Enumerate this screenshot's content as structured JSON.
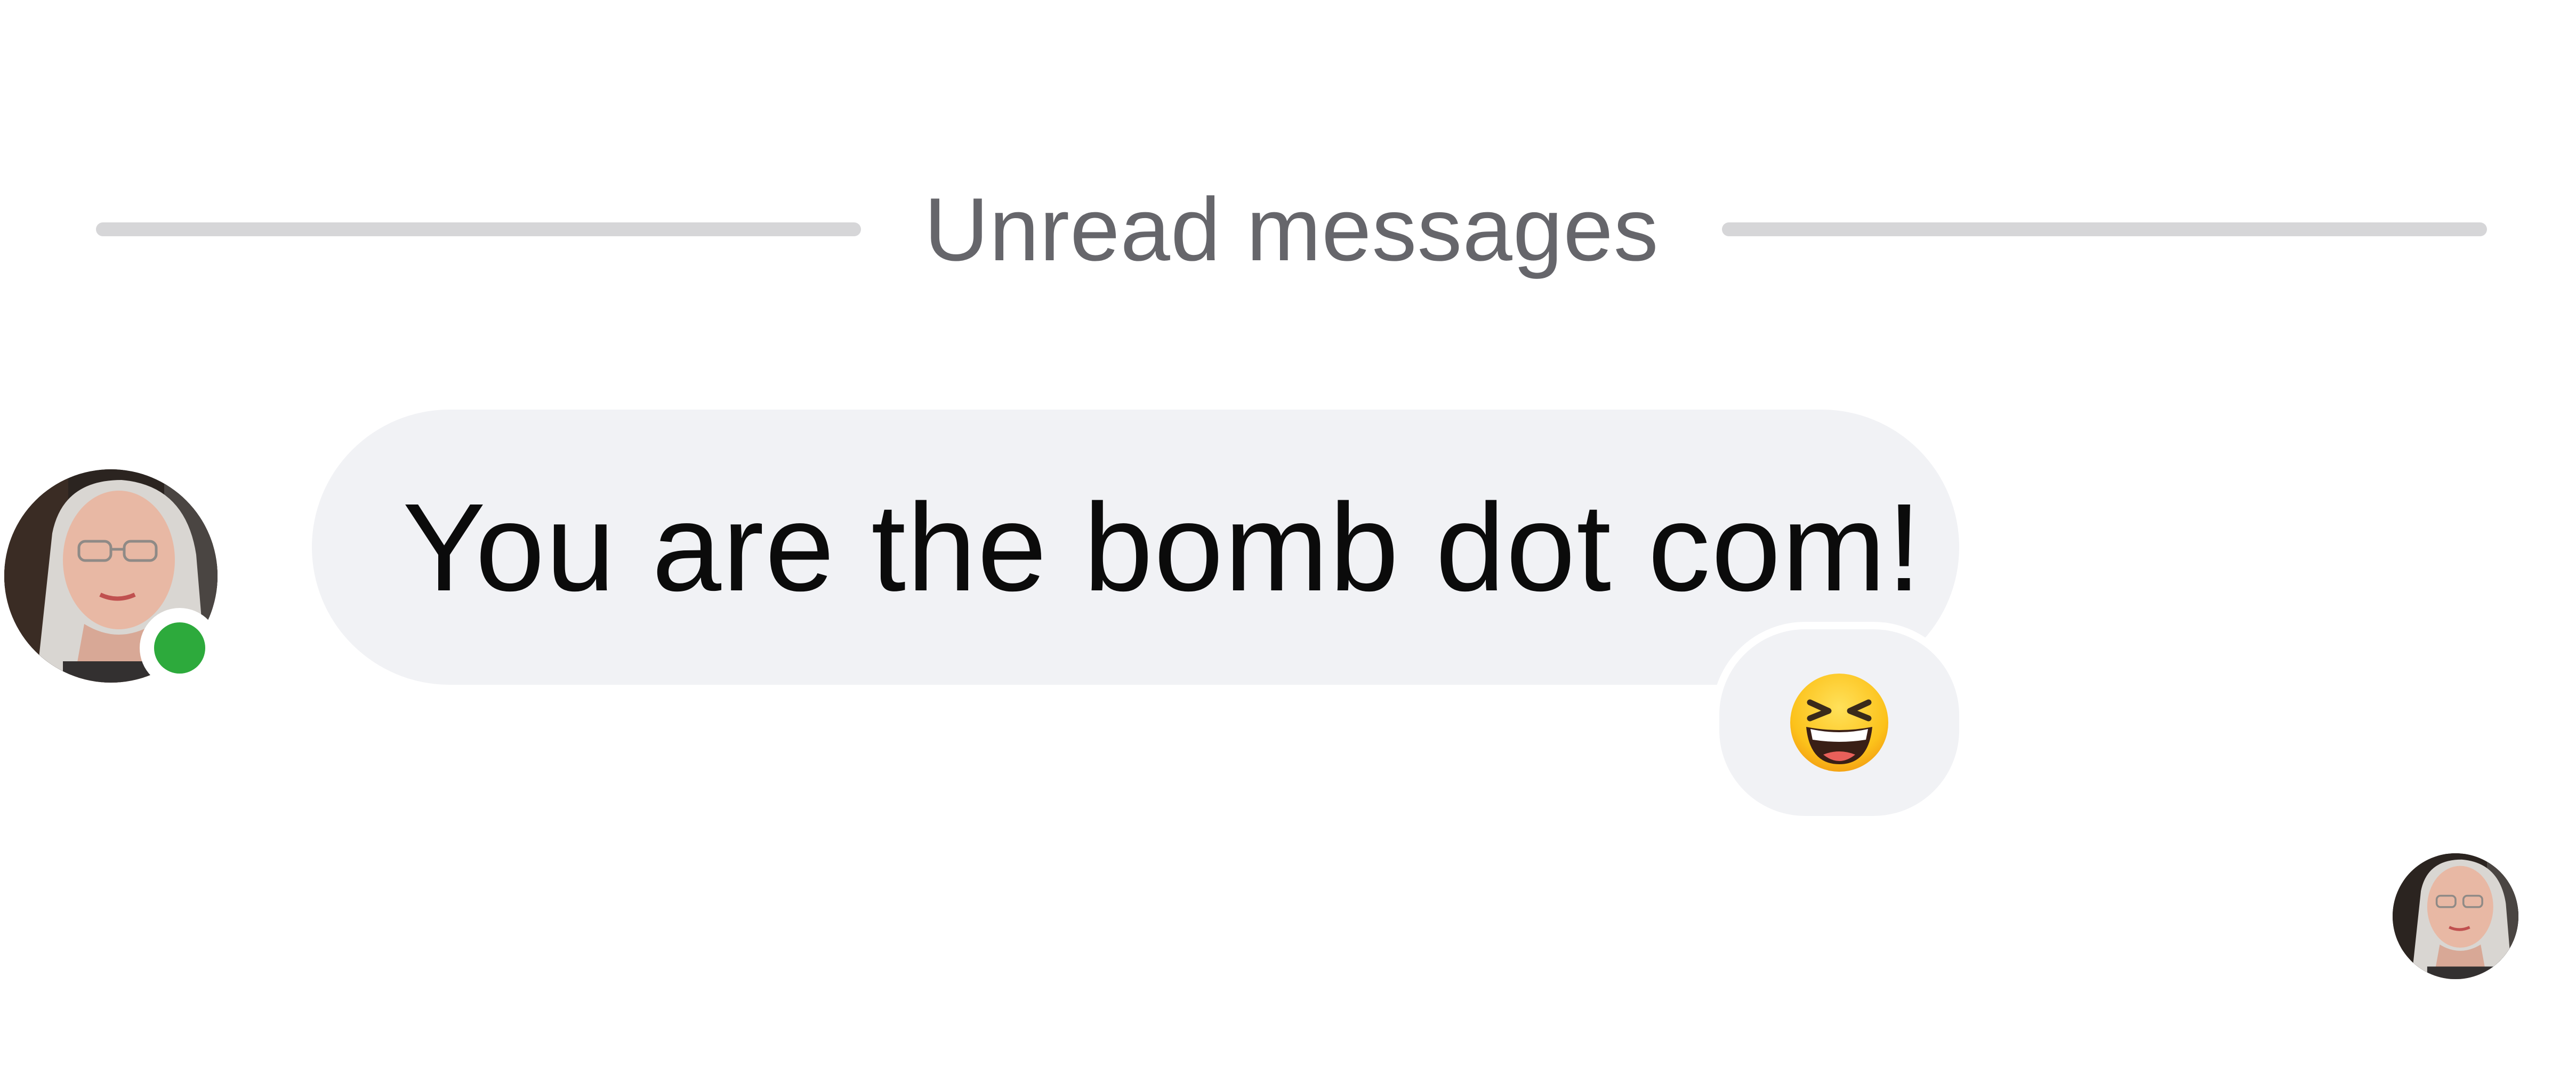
{
  "divider": {
    "label": "Unread messages"
  },
  "message": {
    "text": "You are the bomb dot com!",
    "reaction_icon": "grinning-squinting-face-icon",
    "sender_status": "online"
  },
  "colors": {
    "bubble_bg": "#f1f2f5",
    "divider_line": "#d6d6d8",
    "divider_text": "#66666b",
    "online": "#2daa3c",
    "message_text": "#0b0b0b"
  }
}
